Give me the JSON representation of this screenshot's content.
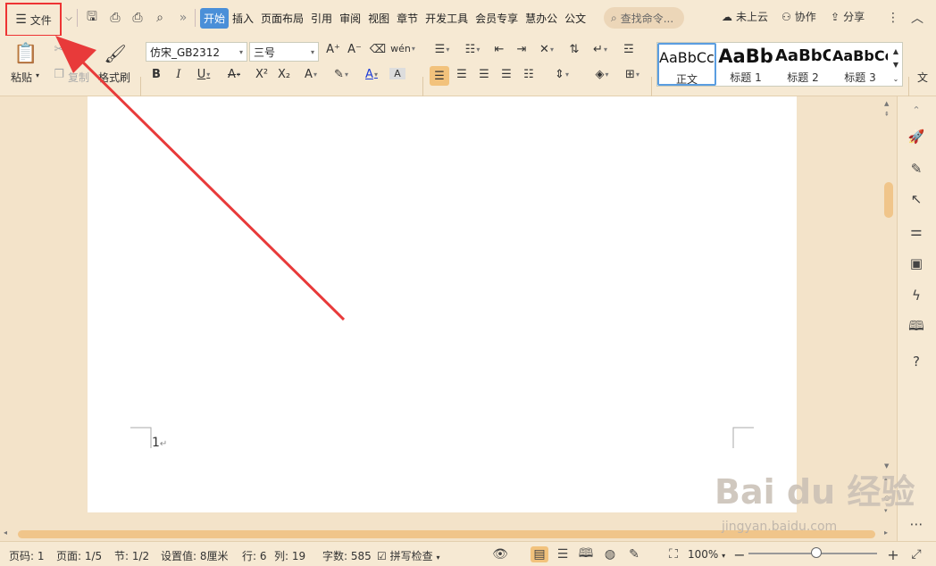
{
  "toolbar": {
    "file_label": "文件",
    "more_label": "»",
    "tabs": [
      "开始",
      "插入",
      "页面布局",
      "引用",
      "审阅",
      "视图",
      "章节",
      "开发工具",
      "会员专享",
      "慧办公",
      "公文"
    ],
    "search_placeholder": "查找命令...",
    "cloud_label": "未上云",
    "collab_label": "协作",
    "share_label": "分享"
  },
  "ribbon": {
    "paste_label": "粘贴",
    "cut_label": "剪切",
    "copy_label": "复制",
    "format_painter_label": "格式刷",
    "font_name": "仿宋_GB2312",
    "font_size": "三号",
    "styles": [
      {
        "preview": "AaBbCcDd",
        "name": "正文"
      },
      {
        "preview": "AaBb",
        "name": "标题 1"
      },
      {
        "preview": "AaBbC",
        "name": "标题 2"
      },
      {
        "preview": "AaBbCcI",
        "name": "标题 3"
      }
    ],
    "right_cut_label": "文"
  },
  "document": {
    "page_number_text": "1",
    "paragraph_mark": "↵"
  },
  "statusbar": {
    "page_code": "页码: 1",
    "page": "页面: 1/5",
    "section": "节: 1/2",
    "setting": "设置值: 8厘米",
    "row": "行: 6",
    "col": "列: 19",
    "word_count": "字数: 585",
    "spell_check": "拼写检查",
    "zoom": "100%"
  },
  "watermark": {
    "brand": "Bai du 经验",
    "url": "jingyan.baidu.com"
  }
}
